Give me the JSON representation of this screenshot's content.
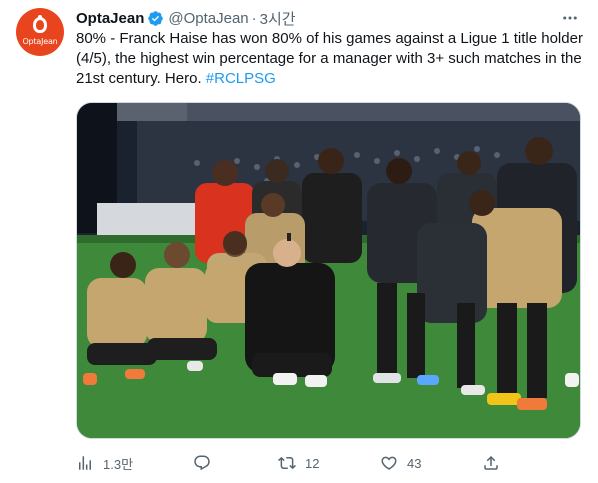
{
  "tweet": {
    "display_name": "OptaJean",
    "handle": "@OptaJean",
    "separator": "·",
    "time": "3시간",
    "text": "80% - Franck Haise has won 80% of his games against a Ligue 1 title holder (4/5), the highest win percentage for a manager with 3+ such matches in the 21st century. Hero.",
    "hashtag": "#RCLPSG",
    "verified": true,
    "avatar": {
      "logo_text": "OptaJean",
      "color": "#e8451e"
    }
  },
  "media": {
    "icon": "photo",
    "scene": "team photo on pitch with crowd in stands"
  },
  "actions": {
    "views": "1.3만",
    "replies": "",
    "retweets": "12",
    "likes": "43",
    "share": ""
  },
  "colors": {
    "text": "#0f1419",
    "secondary": "#536471",
    "link": "#1d9bf0",
    "verified": "#1d9bf0"
  }
}
